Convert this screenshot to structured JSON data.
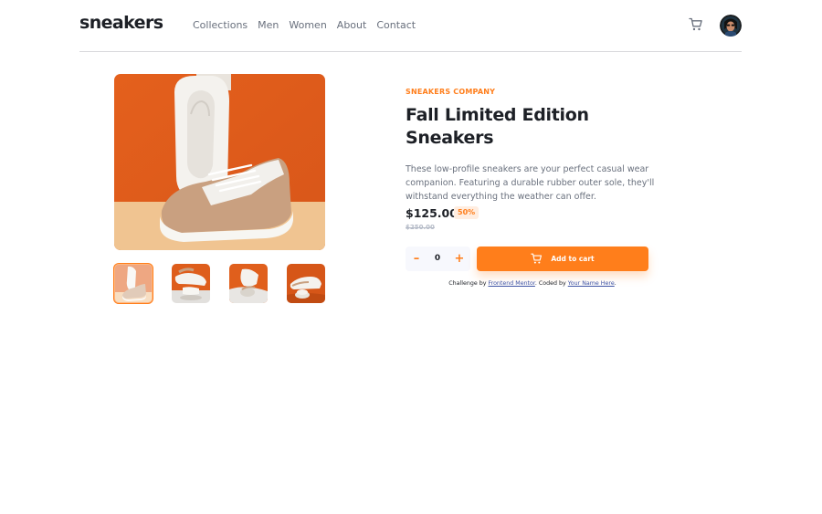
{
  "header": {
    "logo": "sneakers",
    "nav": [
      "Collections",
      "Men",
      "Women",
      "About",
      "Contact"
    ],
    "cart_icon": "cart-icon",
    "avatar": "user-avatar"
  },
  "gallery": {
    "main_image": "sneaker-photo-1",
    "thumbnails": [
      "sneaker-thumb-1",
      "sneaker-thumb-2",
      "sneaker-thumb-3",
      "sneaker-thumb-4"
    ],
    "active_thumbnail": 1
  },
  "product": {
    "company": "SNEAKERS COMPANY",
    "title_line1": "Fall Limited Edition",
    "title_line2": "Sneakers",
    "description": "These low-profile sneakers are your perfect casual wear companion. Featuring a durable rubber outer sole, they'll withstand everything the weather can offer.",
    "price": "$125.00",
    "discount": "50%",
    "original_price": "$250.00"
  },
  "cart_controls": {
    "minus": "–",
    "quantity": "0",
    "plus": "+",
    "add_label": "Add to cart"
  },
  "attribution": {
    "prefix": "Challenge by ",
    "link1": "Frontend Mentor",
    "middle": ". Coded by ",
    "link2": "Your Name Here",
    "suffix": "."
  },
  "colors": {
    "accent": "#ff7e1b",
    "accent_light": "#ffede0",
    "text_dark": "#1d2026",
    "text_gray": "#69707d"
  }
}
